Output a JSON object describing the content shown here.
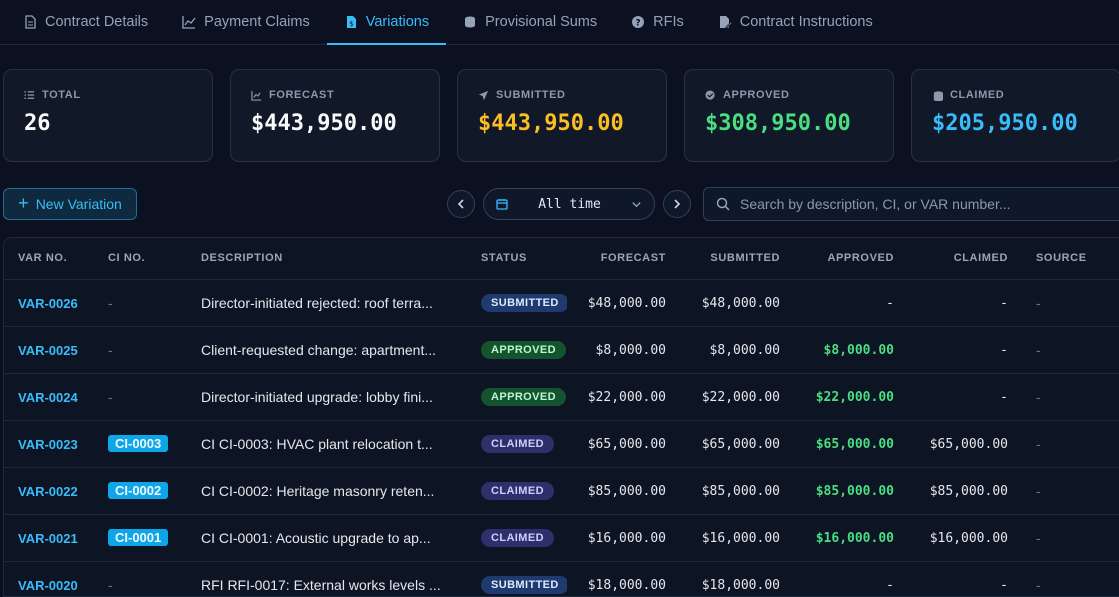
{
  "tabs": [
    {
      "label": "Contract Details",
      "icon": "document-icon",
      "active": false
    },
    {
      "label": "Payment Claims",
      "icon": "chart-line-icon",
      "active": false
    },
    {
      "label": "Variations",
      "icon": "file-dollar-icon",
      "active": true
    },
    {
      "label": "Provisional Sums",
      "icon": "coins-icon",
      "active": false
    },
    {
      "label": "RFIs",
      "icon": "question-circle-icon",
      "active": false
    },
    {
      "label": "Contract Instructions",
      "icon": "file-edit-icon",
      "active": false
    }
  ],
  "stats": [
    {
      "label": "TOTAL",
      "value": "26",
      "color": "#f8fafc",
      "icon": "list-icon"
    },
    {
      "label": "FORECAST",
      "value": "$443,950.00",
      "color": "#f8fafc",
      "icon": "trend-icon"
    },
    {
      "label": "SUBMITTED",
      "value": "$443,950.00",
      "color": "#fbbf24",
      "icon": "send-icon"
    },
    {
      "label": "APPROVED",
      "value": "$308,950.00",
      "color": "#4ade80",
      "icon": "check-circle-icon"
    },
    {
      "label": "CLAIMED",
      "value": "$205,950.00",
      "color": "#38bdf8",
      "icon": "coins-icon"
    }
  ],
  "toolbar": {
    "new_label": "New Variation",
    "time_label": "All time",
    "search_placeholder": "Search by description, CI, or VAR number..."
  },
  "table": {
    "headers": {
      "var": "VAR NO.",
      "ci": "CI NO.",
      "desc": "DESCRIPTION",
      "status": "STATUS",
      "forecast": "FORECAST",
      "submitted": "SUBMITTED",
      "approved": "APPROVED",
      "claimed": "CLAIMED",
      "source": "SOURCE"
    },
    "rows": [
      {
        "var": "VAR-0026",
        "ci": "-",
        "desc": "Director-initiated rejected: roof terra...",
        "status": "SUBMITTED",
        "forecast": "$48,000.00",
        "submitted": "$48,000.00",
        "approved": "-",
        "claimed": "-",
        "source": "-"
      },
      {
        "var": "VAR-0025",
        "ci": "-",
        "desc": "Client-requested change: apartment...",
        "status": "APPROVED",
        "forecast": "$8,000.00",
        "submitted": "$8,000.00",
        "approved": "$8,000.00",
        "claimed": "-",
        "source": "-"
      },
      {
        "var": "VAR-0024",
        "ci": "-",
        "desc": "Director-initiated upgrade: lobby fini...",
        "status": "APPROVED",
        "forecast": "$22,000.00",
        "submitted": "$22,000.00",
        "approved": "$22,000.00",
        "claimed": "-",
        "source": "-"
      },
      {
        "var": "VAR-0023",
        "ci": "CI-0003",
        "desc": "CI CI-0003: HVAC plant relocation t...",
        "status": "CLAIMED",
        "forecast": "$65,000.00",
        "submitted": "$65,000.00",
        "approved": "$65,000.00",
        "claimed": "$65,000.00",
        "source": "-"
      },
      {
        "var": "VAR-0022",
        "ci": "CI-0002",
        "desc": "CI CI-0002: Heritage masonry reten...",
        "status": "CLAIMED",
        "forecast": "$85,000.00",
        "submitted": "$85,000.00",
        "approved": "$85,000.00",
        "claimed": "$85,000.00",
        "source": "-"
      },
      {
        "var": "VAR-0021",
        "ci": "CI-0001",
        "desc": "CI CI-0001: Acoustic upgrade to ap...",
        "status": "CLAIMED",
        "forecast": "$16,000.00",
        "submitted": "$16,000.00",
        "approved": "$16,000.00",
        "claimed": "$16,000.00",
        "source": "-"
      },
      {
        "var": "VAR-0020",
        "ci": "-",
        "desc": "RFI RFI-0017: External works levels ...",
        "status": "SUBMITTED",
        "forecast": "$18,000.00",
        "submitted": "$18,000.00",
        "approved": "-",
        "claimed": "-",
        "source": "-"
      }
    ]
  }
}
